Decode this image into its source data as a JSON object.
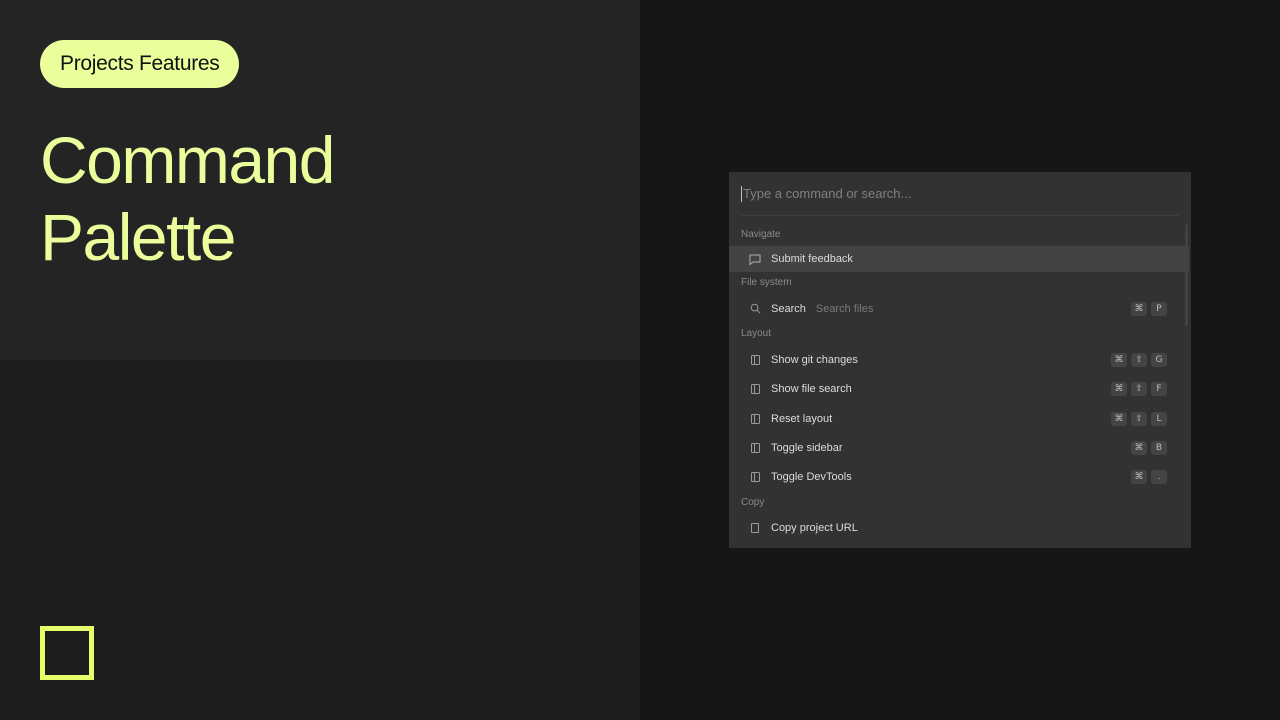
{
  "hero": {
    "badge": "Projects Features",
    "title_line1": "Command",
    "title_line2": "Palette"
  },
  "palette": {
    "search_placeholder": "Type a command or search...",
    "sections": {
      "navigate": "Navigate",
      "file_system": "File system",
      "layout": "Layout",
      "copy": "Copy"
    },
    "items": {
      "submit_feedback": {
        "label": "Submit feedback",
        "icon": "message-icon"
      },
      "search": {
        "label": "Search",
        "hint": "Search files",
        "icon": "search-icon",
        "keys": [
          "⌘",
          "P"
        ]
      },
      "show_git_changes": {
        "label": "Show git changes",
        "icon": "panel-icon",
        "keys": [
          "⌘",
          "⇧",
          "G"
        ]
      },
      "show_file_search": {
        "label": "Show file search",
        "icon": "panel-icon",
        "keys": [
          "⌘",
          "⇧",
          "F"
        ]
      },
      "reset_layout": {
        "label": "Reset layout",
        "icon": "panel-icon",
        "keys": [
          "⌘",
          "⇧",
          "L"
        ]
      },
      "toggle_sidebar": {
        "label": "Toggle sidebar",
        "icon": "panel-icon",
        "keys": [
          "⌘",
          "B"
        ]
      },
      "toggle_devtools": {
        "label": "Toggle DevTools",
        "icon": "panel-icon",
        "keys": [
          "⌘",
          "."
        ]
      },
      "copy_project_url": {
        "label": "Copy project URL",
        "icon": "copy-icon"
      }
    }
  },
  "colors": {
    "accent": "#eaff9c",
    "logo": "#e4ff6b",
    "palette_bg": "#323232",
    "selected_bg": "#434343"
  }
}
